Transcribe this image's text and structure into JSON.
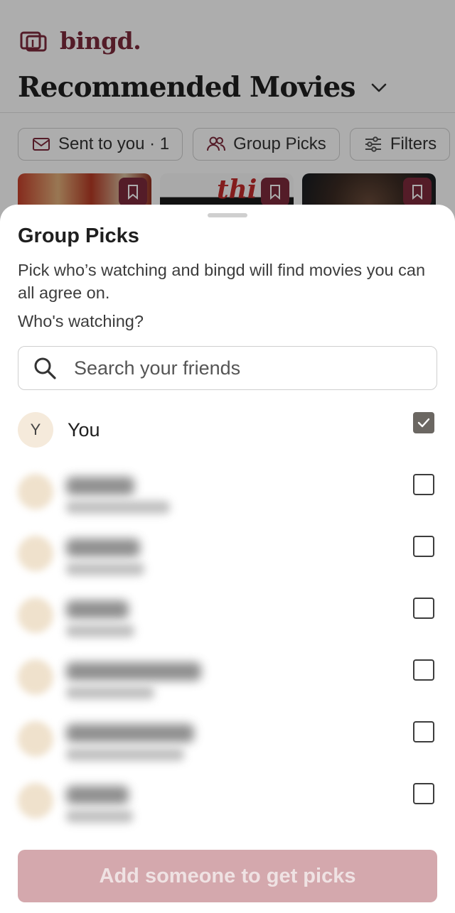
{
  "app": {
    "brand": "bingd.",
    "page_title": "Recommended Movies",
    "chips": [
      {
        "label": "Sent to you · 1",
        "icon": "mail-icon"
      },
      {
        "label": "Group Picks",
        "icon": "users-icon"
      },
      {
        "label": "Filters",
        "icon": "sliders-icon"
      }
    ],
    "poster_text": "thi"
  },
  "sheet": {
    "title": "Group Picks",
    "description": "Pick who’s watching and bingd will find movies you can all agree on.",
    "question": "Who's watching?",
    "search_placeholder": "Search your friends",
    "self": {
      "initial": "Y",
      "name": "You",
      "checked": true
    },
    "friends_count_blurred": 6,
    "cta_label": "Add someone to get picks"
  },
  "colors": {
    "brand": "#7c2a3b",
    "cta_disabled": "#d4a8ad",
    "avatar_bg": "#f5eadb",
    "checkbox_checked": "#6b6762"
  }
}
